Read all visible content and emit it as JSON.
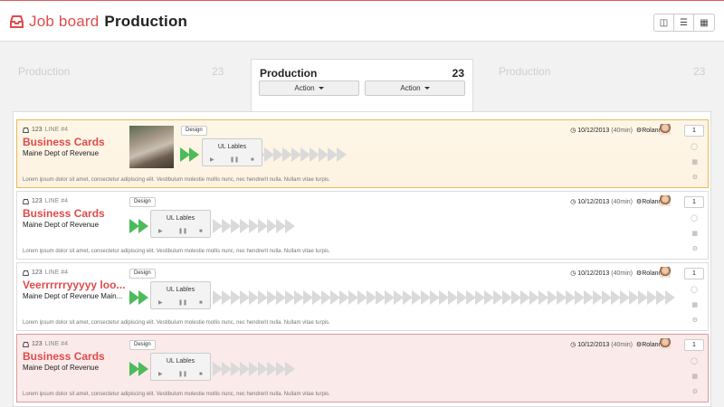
{
  "header": {
    "brand": "Job board",
    "board_name": "Production"
  },
  "view_icons": [
    "columns-icon",
    "list-icon",
    "table-icon"
  ],
  "columns": {
    "left": {
      "title": "Production",
      "count": "23"
    },
    "center": {
      "title": "Production",
      "count": "23",
      "action1": "Action",
      "action2": "Action"
    },
    "right": {
      "title": "Production",
      "count": "23"
    }
  },
  "cards": [
    {
      "id": "123",
      "line": "LINE #4",
      "title": "Business Cards",
      "customer": "Maine Dept of Revenue",
      "tag": "Design",
      "player_label": "UL Lables",
      "date": "10/12/2013",
      "minutes": "(40min)",
      "user": "Roland",
      "count": "1",
      "has_thumb": true,
      "arrow_total": 10,
      "description": "Lorem ipsum dolor sit amet, consectetur adipiscing elit. Vestibulum molestie mollis nunc, nec hendrerit nulla. Nullam vitae turpis."
    },
    {
      "id": "123",
      "line": "LINE #4",
      "title": "Business Cards",
      "customer": "Maine Dept of Revenue",
      "tag": "Design",
      "player_label": "UL Lables",
      "date": "10/12/2013",
      "minutes": "(40min)",
      "user": "Roland",
      "count": "1",
      "has_thumb": false,
      "arrow_total": 13,
      "description": "Lorem ipsum dolor sit amet, consectetur adipiscing elit. Vestibulum molestie mollis nunc, nec hendrerit nulla. Nullam vitae turpis."
    },
    {
      "id": "123",
      "line": "LINE #4",
      "title": "Veerrrrrryyyyy loo...",
      "customer": "Maine Dept of Revenue Main...",
      "tag": "Design",
      "player_label": "UL Lables",
      "date": "10/12/2013",
      "minutes": "(40min)",
      "user": "Roland",
      "count": "1",
      "has_thumb": false,
      "arrow_total": 48,
      "description": "Lorem ipsum dolor sit amet, consectetur adipiscing elit. Vestibulum molestie mollis nunc, nec hendrerit nulla. Nullam vitae turpis."
    },
    {
      "id": "123",
      "line": "LINE #4",
      "title": "Business Cards",
      "customer": "Maine Dept of Revenue",
      "tag": "Design",
      "player_label": "UL Lables",
      "date": "10/12/2013",
      "minutes": "(40min)",
      "user": "Roland",
      "count": "1",
      "has_thumb": false,
      "arrow_total": 13,
      "description": "Lorem ipsum dolor sit amet, consectetur adipiscing elit. Vestibulum molestie mollis nunc, nec hendrerit nulla. Nullam vitae turpis."
    }
  ],
  "colors": {
    "accent": "#e04b4b",
    "progress_done": "#4cbb5a",
    "progress_todo": "#dadada",
    "highlight": "#fdf6e7",
    "alert": "#fbeaea"
  }
}
